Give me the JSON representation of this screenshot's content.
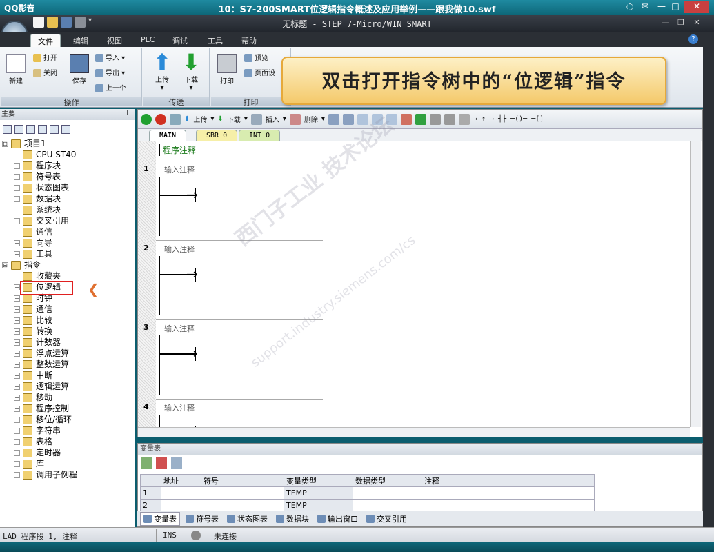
{
  "qq": {
    "app_name": "QQ影音",
    "title": "10：S7-200SMART位逻辑指令概述及应用举例——跟我做10.swf",
    "ctl_icons": [
      "pin",
      "skin",
      "min",
      "max",
      "close"
    ]
  },
  "app": {
    "title": "无标题 - STEP 7-Micro/WIN SMART"
  },
  "menu": {
    "tabs": [
      "文件",
      "编辑",
      "视图",
      "PLC",
      "调试",
      "工具",
      "帮助"
    ],
    "active": "文件"
  },
  "ribbon": {
    "new_label": "新建",
    "open_label": "打开",
    "close_label": "关闭",
    "save_label": "保存",
    "import_label": "导入",
    "export_label": "导出",
    "prev_label": "上一个",
    "group_ops": "操作",
    "upload_label": "上传",
    "download_label": "下载",
    "group_transfer": "传送",
    "print_label": "打印",
    "preview_label": "预览",
    "pagesetup_label": "页面设",
    "group_print": "打印"
  },
  "callout": {
    "text": "双击打开指令树中的“位逻辑”指令"
  },
  "tree": {
    "header": "主要",
    "items": [
      {
        "label": "项目1",
        "exp": "⊟",
        "indent": 0
      },
      {
        "label": "CPU ST40",
        "exp": "",
        "indent": 1
      },
      {
        "label": "程序块",
        "exp": "+",
        "indent": 1
      },
      {
        "label": "符号表",
        "exp": "+",
        "indent": 1
      },
      {
        "label": "状态图表",
        "exp": "+",
        "indent": 1
      },
      {
        "label": "数据块",
        "exp": "+",
        "indent": 1
      },
      {
        "label": "系统块",
        "exp": "",
        "indent": 1
      },
      {
        "label": "交叉引用",
        "exp": "+",
        "indent": 1
      },
      {
        "label": "通信",
        "exp": "",
        "indent": 1
      },
      {
        "label": "向导",
        "exp": "+",
        "indent": 1
      },
      {
        "label": "工具",
        "exp": "+",
        "indent": 1
      },
      {
        "label": "指令",
        "exp": "⊟",
        "indent": 0
      },
      {
        "label": "收藏夹",
        "exp": "",
        "indent": 1
      },
      {
        "label": "位逻辑",
        "exp": "+",
        "indent": 1
      },
      {
        "label": "时钟",
        "exp": "+",
        "indent": 1
      },
      {
        "label": "通信",
        "exp": "+",
        "indent": 1
      },
      {
        "label": "比较",
        "exp": "+",
        "indent": 1
      },
      {
        "label": "转换",
        "exp": "+",
        "indent": 1
      },
      {
        "label": "计数器",
        "exp": "+",
        "indent": 1
      },
      {
        "label": "浮点运算",
        "exp": "+",
        "indent": 1
      },
      {
        "label": "整数运算",
        "exp": "+",
        "indent": 1
      },
      {
        "label": "中断",
        "exp": "+",
        "indent": 1
      },
      {
        "label": "逻辑运算",
        "exp": "+",
        "indent": 1
      },
      {
        "label": "移动",
        "exp": "+",
        "indent": 1
      },
      {
        "label": "程序控制",
        "exp": "+",
        "indent": 1
      },
      {
        "label": "移位/循环",
        "exp": "+",
        "indent": 1
      },
      {
        "label": "字符串",
        "exp": "+",
        "indent": 1
      },
      {
        "label": "表格",
        "exp": "+",
        "indent": 1
      },
      {
        "label": "定时器",
        "exp": "+",
        "indent": 1
      },
      {
        "label": "库",
        "exp": "+",
        "indent": 1
      },
      {
        "label": "调用子例程",
        "exp": "+",
        "indent": 1
      }
    ],
    "highlight_arrow": "❮"
  },
  "editor": {
    "toolbar": {
      "upload": "上传",
      "download": "下载",
      "insert": "插入",
      "delete": "删除"
    },
    "tabs": [
      "MAIN",
      "SBR_0",
      "INT_0"
    ],
    "program_comment": "程序注释",
    "networks": [
      {
        "num": "1",
        "comment": "输入注释"
      },
      {
        "num": "2",
        "comment": "输入注释"
      },
      {
        "num": "3",
        "comment": "输入注释"
      },
      {
        "num": "4",
        "comment": "输入注释"
      }
    ]
  },
  "watermark": {
    "line1": "西门子工业 技术论坛",
    "line2": "support.industry.siemens.com/cs"
  },
  "vartable": {
    "header": "变量表",
    "columns": [
      "",
      "地址",
      "符号",
      "变量类型",
      "数据类型",
      "注释"
    ],
    "rows": [
      [
        "1",
        "",
        "",
        "TEMP",
        "",
        ""
      ],
      [
        "2",
        "",
        "",
        "TEMP",
        "",
        ""
      ]
    ]
  },
  "bottom_tabs": [
    "变量表",
    "符号表",
    "状态图表",
    "数据块",
    "输出窗口",
    "交叉引用"
  ],
  "status": {
    "mode": "LAD 程序段 1, 注释",
    "ins": "INS",
    "conn": "未连接"
  }
}
